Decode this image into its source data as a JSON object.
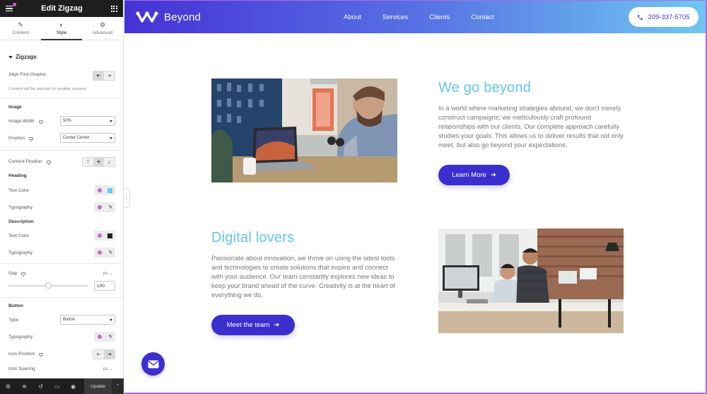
{
  "panel": {
    "title": "Edit Zigzag",
    "tabs": [
      {
        "label": "Content",
        "icon": "pencil-icon"
      },
      {
        "label": "Style",
        "icon": "half-circle-icon",
        "active": true
      },
      {
        "label": "Advanced",
        "icon": "gear-icon"
      }
    ],
    "section_title": "Zigzags",
    "controls": {
      "align_first_graphic": "Align First Graphic",
      "stack_note": "Content will be stacked on smaller screens",
      "image_heading": "Image",
      "image_width_label": "Image Width",
      "image_width_value": "50%",
      "position_label": "Position",
      "position_value": "Center Center",
      "content_position_label": "Content Position",
      "heading_heading": "Heading",
      "heading_text_color": "Text Color",
      "heading_typography": "Typography",
      "description_heading": "Description",
      "description_text_color": "Text Color",
      "description_typography": "Typography",
      "gap_label": "Gap",
      "gap_unit": "px",
      "gap_value": "100",
      "gap_slider_fraction": 0.5,
      "button_heading": "Button",
      "type_label": "Type",
      "type_value": "Button",
      "button_typography": "Typography",
      "icon_position_label": "Icon Position",
      "icon_spacing_label": "Icon Spacing",
      "icon_spacing_unit": "px"
    },
    "colors": {
      "heading_swatch": "#5bcdf2",
      "description_swatch": "#222222",
      "global_dot": "#c26bd6"
    },
    "footer": {
      "icons": [
        "gear-icon",
        "layers-icon",
        "history-icon",
        "responsive-icon",
        "eye-icon"
      ],
      "update_label": "Update"
    }
  },
  "site": {
    "logo_text": "Beyond",
    "nav": [
      "About",
      "Services",
      "Clients",
      "Contact"
    ],
    "phone": "209-337-5705",
    "colors": {
      "primary": "#3c2fcf",
      "accent": "#63c6ec",
      "gradient_end": "#6fc7f1"
    },
    "features": [
      {
        "title": "We go beyond",
        "text": "In a world where marketing strategies abound, we don't merely construct campaigns; we meticulously craft profound relationships with our clients. Our complete approach carefully studies your goals. This allows us to deliver results that not only meet, but also go beyond your expectations.",
        "button": "Learn More"
      },
      {
        "title": "Digital lovers",
        "text": "Passionate about innovation, we thrive on using the latest tools and technologies to create solutions that inspire and connect with your audience. Our team constantly explores new ideas to keep your brand ahead of the curve. Creativity is at the heart of everything we do.",
        "button": "Meet the team"
      }
    ]
  }
}
